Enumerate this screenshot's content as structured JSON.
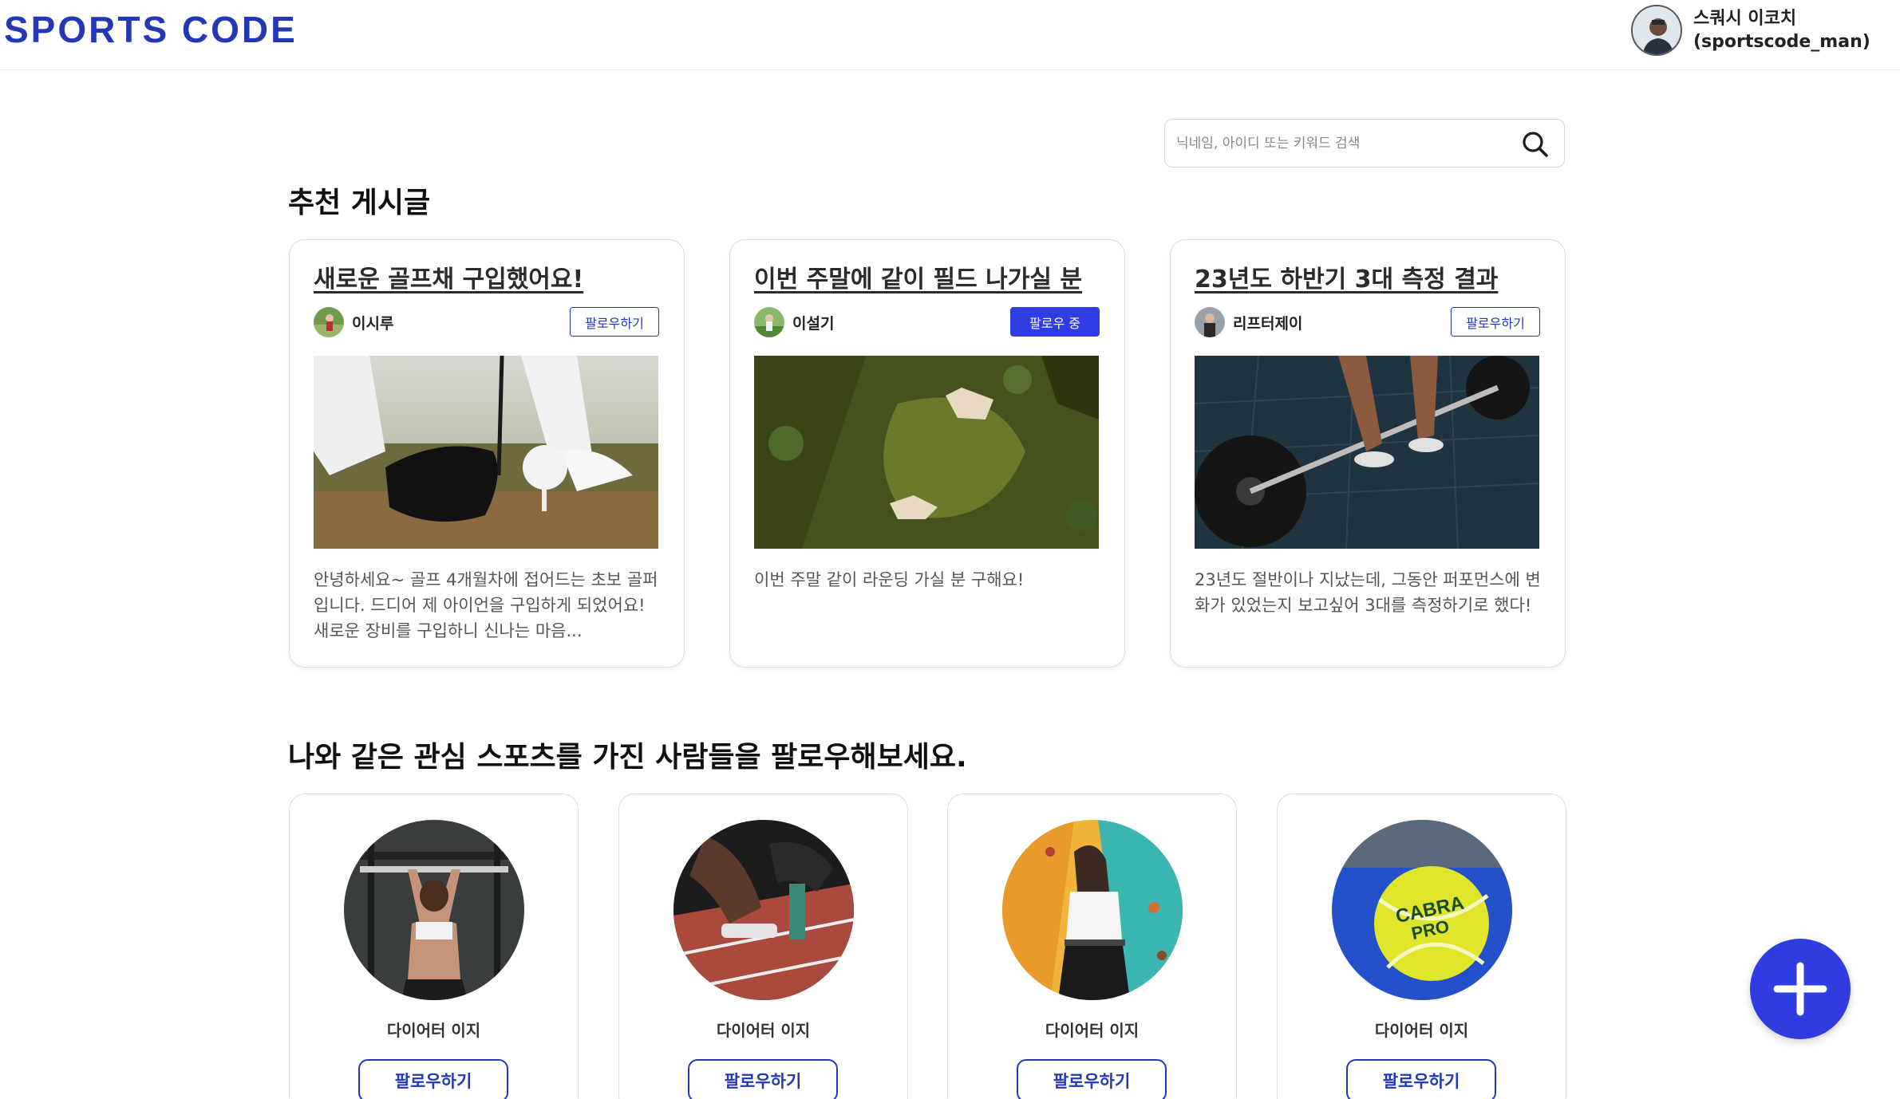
{
  "header": {
    "logo": "SPORTS CODE",
    "user_name": "스쿼시 이코치",
    "user_id": "(sportscode_man)"
  },
  "search": {
    "placeholder": "닉네임, 아이디 또는 키워드 검색",
    "icon": "search-icon"
  },
  "recommended": {
    "title": "추천 게시글",
    "posts": [
      {
        "title": "새로운 골프채 구입했어요!",
        "author": "이시루",
        "follow_label": "팔로우하기",
        "following": false,
        "body": "안녕하세요~ 골프 4개월차에 접어드는 초보 골퍼입니다. 드디어 제 아이언을 구입하게 되었어요! 새로운 장비를 구입하니 신나는 마음..."
      },
      {
        "title": "이번 주말에 같이 필드 나가실 분",
        "author": "이설기",
        "follow_label": "팔로우 중",
        "following": true,
        "body": "이번 주말 같이 라운딩 가실 분 구해요!"
      },
      {
        "title": "23년도 하반기 3대 측정 결과",
        "author": "리프터제이",
        "follow_label": "팔로우하기",
        "following": false,
        "body": "23년도 절반이나 지났는데, 그동안 퍼포먼스에 변화가 있었는지 보고싶어 3대를 측정하기로 했다!"
      }
    ]
  },
  "people": {
    "title": "나와 같은 관심 스포츠를 가진 사람들을 팔로우해보세요.",
    "cards": [
      {
        "name": "다이어터 이지",
        "follow_label": "팔로우하기"
      },
      {
        "name": "다이어터 이지",
        "follow_label": "팔로우하기"
      },
      {
        "name": "다이어터 이지",
        "follow_label": "팔로우하기"
      },
      {
        "name": "다이어터 이지",
        "follow_label": "팔로우하기"
      }
    ]
  },
  "colors": {
    "brand": "#2438b5",
    "primary_button": "#2f3ee2",
    "fab": "#2e3ce0"
  },
  "fab_icon": "plus-icon"
}
